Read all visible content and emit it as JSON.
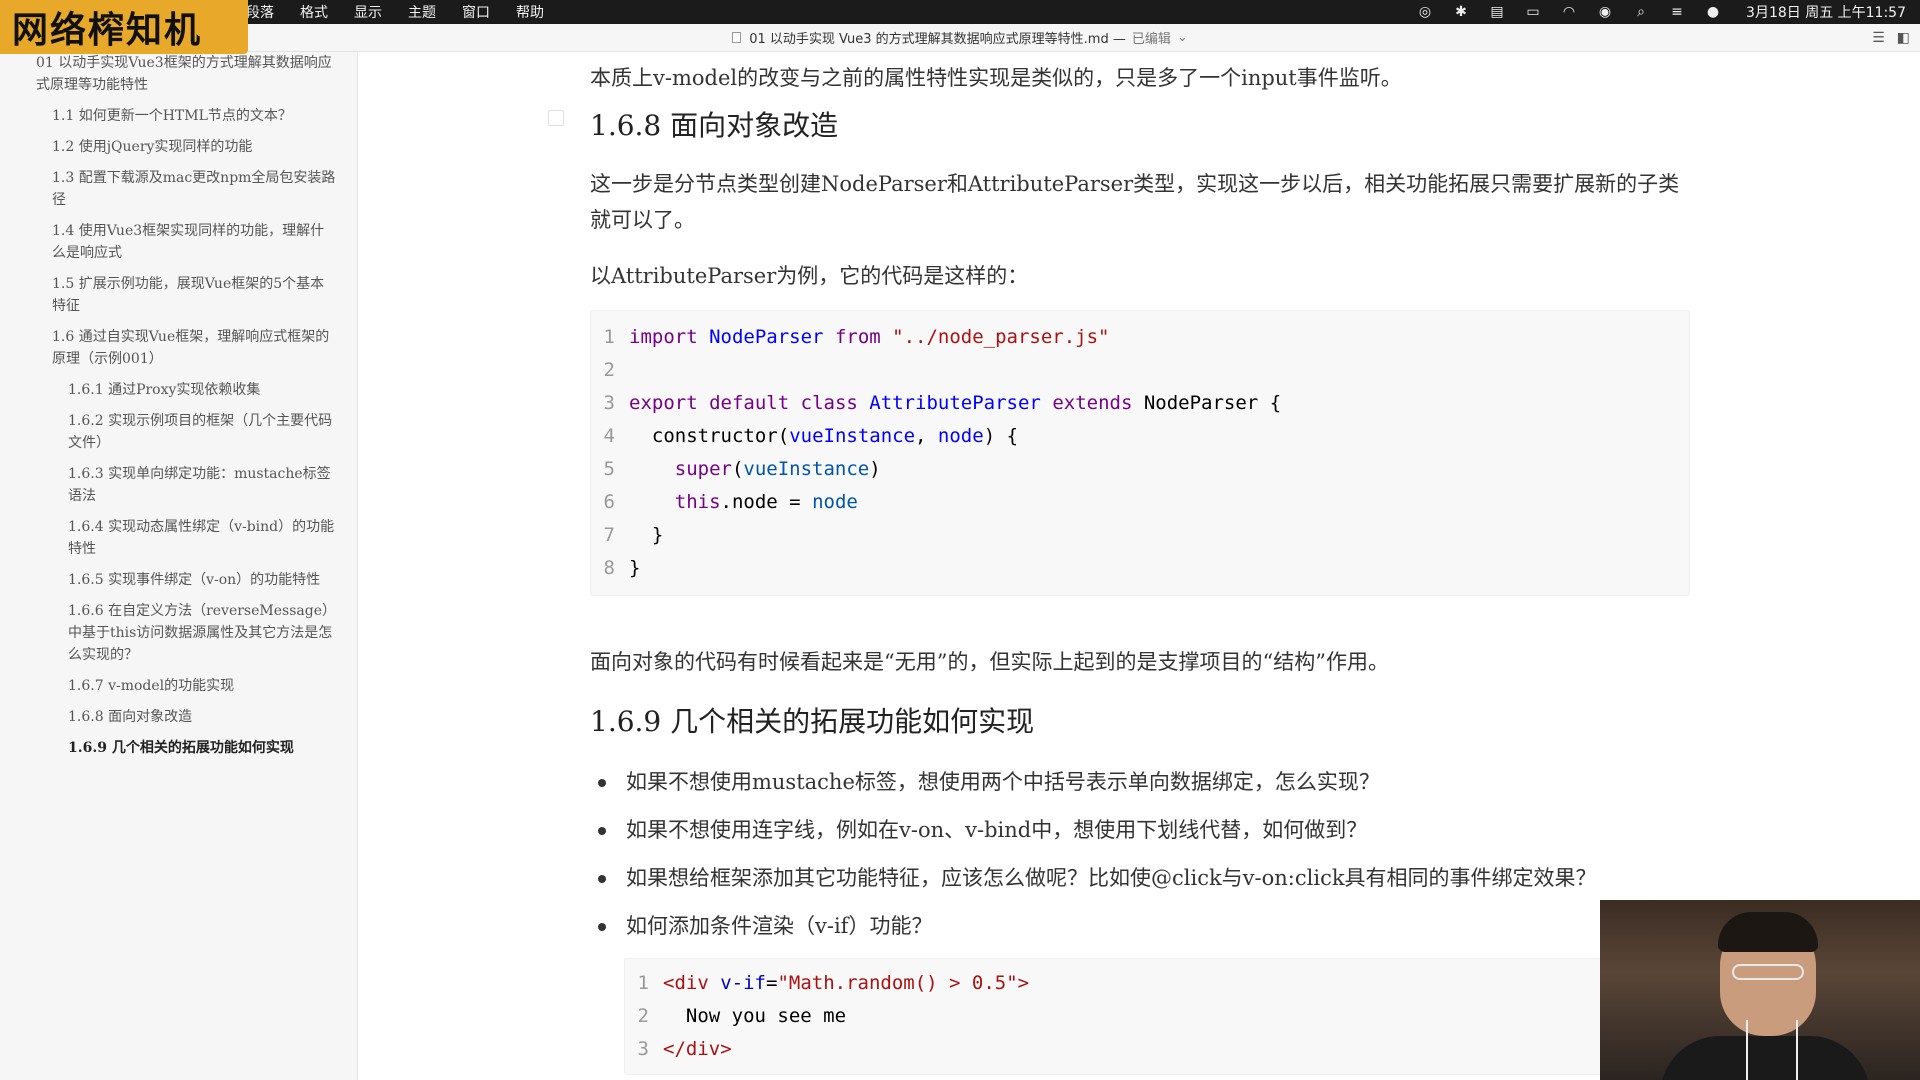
{
  "watermark": "网络榨知机",
  "menubar": {
    "menus": [
      "段落",
      "格式",
      "显示",
      "主题",
      "窗口",
      "帮助"
    ],
    "clock": "3月18日 周五 上午11:57"
  },
  "titlebar": {
    "title": "01 以动手实现 Vue3 的方式理解其数据响应式原理等特性.md —",
    "status": "已编辑"
  },
  "sidebar": {
    "items": [
      {
        "label": "01 以动手实现Vue3框架的方式理解其数据响应式原理等功能特性",
        "level": 0
      },
      {
        "label": "1.1 如何更新一个HTML节点的文本？",
        "level": 1
      },
      {
        "label": "1.2 使用jQuery实现同样的功能",
        "level": 1
      },
      {
        "label": "1.3 配置下载源及mac更改npm全局包安装路径",
        "level": 1
      },
      {
        "label": "1.4 使用Vue3框架实现同样的功能，理解什么是响应式",
        "level": 1
      },
      {
        "label": "1.5 扩展示例功能，展现Vue框架的5个基本特征",
        "level": 1
      },
      {
        "label": "1.6 通过自实现Vue框架，理解响应式框架的原理（示例001）",
        "level": 1
      },
      {
        "label": "1.6.1 通过Proxy实现依赖收集",
        "level": 2
      },
      {
        "label": "1.6.2 实现示例项目的框架（几个主要代码文件）",
        "level": 2
      },
      {
        "label": "1.6.3 实现单向绑定功能：mustache标签语法",
        "level": 2
      },
      {
        "label": "1.6.4 实现动态属性绑定（v-bind）的功能特性",
        "level": 2
      },
      {
        "label": "1.6.5 实现事件绑定（v-on）的功能特性",
        "level": 2
      },
      {
        "label": "1.6.6 在自定义方法（reverseMessage）中基于this访问数据源属性及其它方法是怎么实现的？",
        "level": 2
      },
      {
        "label": "1.6.7 v-model的功能实现",
        "level": 2
      },
      {
        "label": "1.6.8 面向对象改造",
        "level": 2
      },
      {
        "label": "1.6.9 几个相关的拓展功能如何实现",
        "level": 2,
        "active": true
      }
    ]
  },
  "content": {
    "intro": "本质上v-model的改变与之前的属性特性实现是类似的，只是多了一个input事件监听。",
    "h_168": "1.6.8 面向对象改造",
    "p1": "这一步是分节点类型创建NodeParser和AttributeParser类型，实现这一步以后，相关功能拓展只需要扩展新的子类就可以了。",
    "p2": "以AttributeParser为例，它的代码是这样的：",
    "code1": {
      "line_numbers": [
        "1",
        "2",
        "3",
        "4",
        "5",
        "6",
        "7",
        "8"
      ],
      "t": {
        "import": "import",
        "NodeParser": "NodeParser",
        "from": "from",
        "path": "\"../node_parser.js\"",
        "export": "export",
        "default": "default",
        "class": "class",
        "AttributeParser": "AttributeParser",
        "extends": "extends",
        "NodeParser2": "NodeParser",
        "brace_open": " {",
        "constructor": "constructor",
        "vueInstance": "vueInstance",
        "node": "node",
        "super": "super",
        "this": "this",
        "dotnode": ".node",
        "eq": " = ",
        "node2": "node",
        "close1": "  }",
        "close2": "}"
      }
    },
    "p3": "面向对象的代码有时候看起来是“无用”的，但实际上起到的是支撑项目的“结构”作用。",
    "h_169": "1.6.9 几个相关的拓展功能如何实现",
    "bullets": [
      "如果不想使用mustache标签，想使用两个中括号表示单向数据绑定，怎么实现？",
      "如果不想使用连字线，例如在v-on、v-bind中，想使用下划线代替，如何做到？",
      "如果想给框架添加其它功能特征，应该怎么做呢？比如使@click与v-on:click具有相同的事件绑定效果？",
      "如何添加条件渲染（v-if）功能？"
    ],
    "code2": {
      "line_numbers": [
        "1",
        "2",
        "3"
      ],
      "t": {
        "open": "<div",
        "attr": "v-if",
        "eq": "=",
        "val": "\"Math.random() > 0.5\"",
        "gt": ">",
        "text": "  Now you see me",
        "close": "</div>"
      }
    }
  }
}
